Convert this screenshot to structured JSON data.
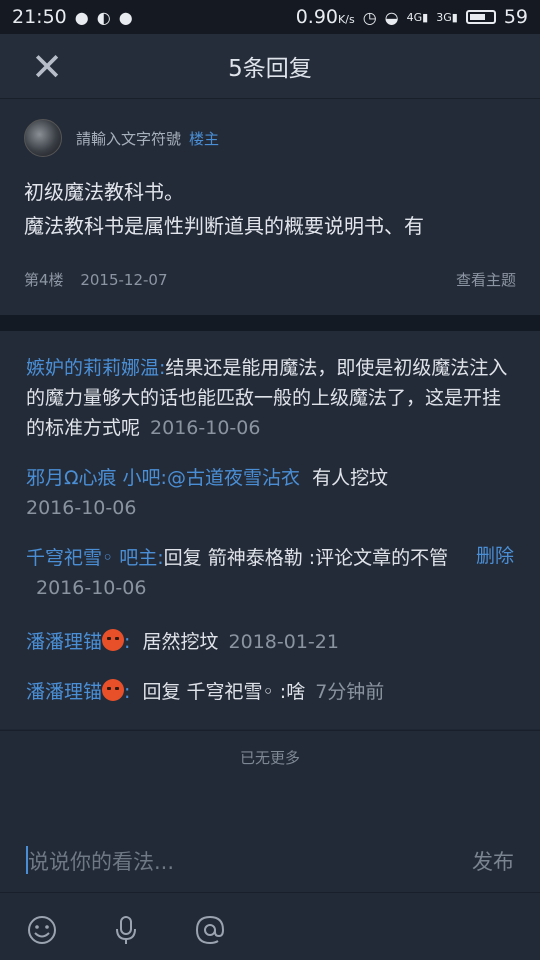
{
  "status_bar": {
    "time": "21:50",
    "speed": "0.90",
    "speed_unit": "K/s",
    "signal_4g": "4G",
    "signal_3g": "3G",
    "battery": "59"
  },
  "header": {
    "title": "5条回复"
  },
  "post": {
    "author": "請輸入文字符號",
    "badge": "楼主",
    "line1": "初级魔法教科书。",
    "line2": "魔法教科书是属性判断道具的概要说明书、有",
    "floor": "第4楼",
    "date": "2015-12-07",
    "view_topic": "查看主题"
  },
  "replies": [
    {
      "user": "嫉妒的莉莉娜温:",
      "text": "结果还是能用魔法，即使是初级魔法注入的魔力量够大的话也能匹敌一般的上级魔法了，这是开挂的标准方式呢",
      "time": "2016-10-06"
    },
    {
      "user": "邪月Ω心痕 小吧:",
      "mention": "@古道夜雪沾衣",
      "text": "有人挖坟",
      "time": "2016-10-06"
    },
    {
      "user": "千穹祀雪◦ 吧主:",
      "text": "回复 箭神泰格勒 :评论文章的不管",
      "time": "2016-10-06",
      "action": "删除"
    },
    {
      "user": "潘潘理锚",
      "emoji": "angry-emoji",
      "sep": ":",
      "text": "居然挖坟",
      "time": "2018-01-21"
    },
    {
      "user": "潘潘理锚",
      "emoji": "angry-emoji",
      "sep": ":",
      "text": "回复 千穹祀雪◦ :啥",
      "time": "7分钟前"
    }
  ],
  "no_more": "已无更多",
  "composer": {
    "placeholder": "说说你的看法...",
    "send": "发布"
  },
  "toolbar": {
    "icons": [
      "emoji-icon",
      "microphone-icon",
      "at-icon"
    ]
  }
}
